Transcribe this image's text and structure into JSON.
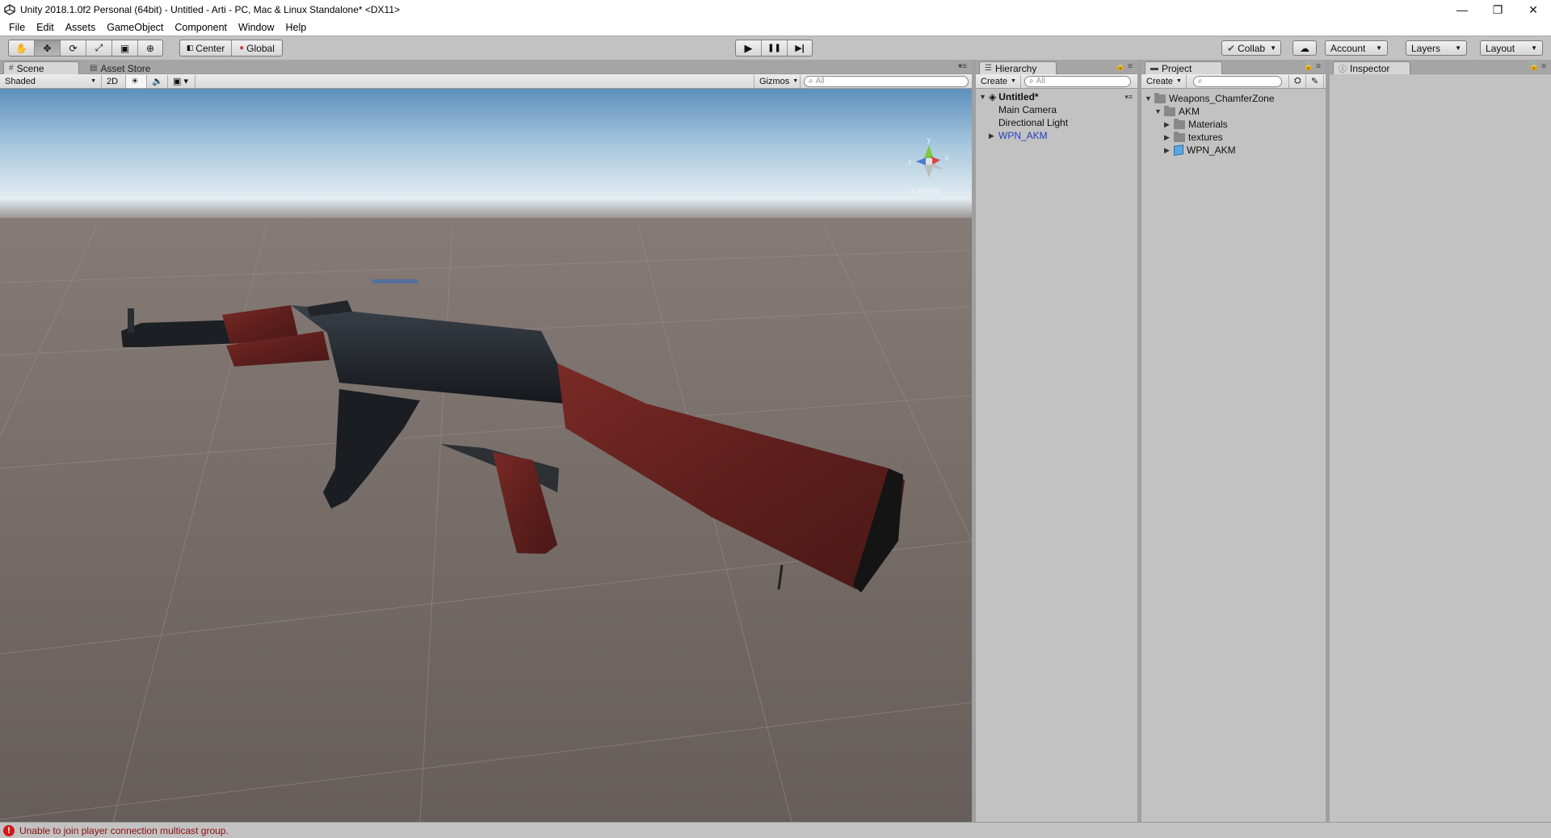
{
  "window": {
    "title": "Unity 2018.1.0f2 Personal (64bit) - Untitled - Arti - PC, Mac & Linux Standalone* <DX11>",
    "controls": [
      "—",
      "❐",
      "✕"
    ]
  },
  "menu": [
    "File",
    "Edit",
    "Assets",
    "GameObject",
    "Component",
    "Window",
    "Help"
  ],
  "toolbar": {
    "tools": [
      {
        "name": "hand-tool-icon",
        "glyph": "✋",
        "active": false
      },
      {
        "name": "move-tool-icon",
        "glyph": "✥",
        "active": true
      },
      {
        "name": "rotate-tool-icon",
        "glyph": "⟳",
        "active": false
      },
      {
        "name": "scale-tool-icon",
        "glyph": "⤢",
        "active": false
      },
      {
        "name": "rect-tool-icon",
        "glyph": "▣",
        "active": false
      },
      {
        "name": "transform-tool-icon",
        "glyph": "⊕",
        "active": false
      }
    ],
    "pivot_label": "Center",
    "space_label": "Global",
    "play": "▶",
    "pause": "❚❚",
    "step": "▶|",
    "collab_label": "Collab",
    "account_label": "Account",
    "layers_label": "Layers",
    "layout_label": "Layout"
  },
  "scene": {
    "tab_label": "Scene",
    "asset_store_label": "Asset Store",
    "draw_mode": "Shaded",
    "mode_2d": "2D",
    "gizmos_label": "Gizmos",
    "search_placeholder": "All",
    "persp_label": "< Persp",
    "axis_y": "y",
    "axis_x": "x",
    "axis_z": "z"
  },
  "hierarchy": {
    "tab_label": "Hierarchy",
    "create_label": "Create",
    "search_placeholder": "All",
    "scene_name": "Untitled*",
    "items": [
      {
        "label": "Main Camera",
        "color": "#111111"
      },
      {
        "label": "Directional Light",
        "color": "#111111"
      },
      {
        "label": "WPN_AKM",
        "color": "#1f3fbf"
      }
    ]
  },
  "project": {
    "tab_label": "Project",
    "create_label": "Create",
    "tree": [
      {
        "label": "Weapons_ChamferZone",
        "expanded": true
      },
      {
        "label": "AKM",
        "expanded": true
      },
      {
        "label": "Materials",
        "expanded": false
      },
      {
        "label": "textures",
        "expanded": false
      },
      {
        "label": "WPN_AKM",
        "expanded": false
      }
    ]
  },
  "inspector": {
    "tab_label": "Inspector"
  },
  "status": {
    "message": "Unable to join player connection multicast group."
  }
}
